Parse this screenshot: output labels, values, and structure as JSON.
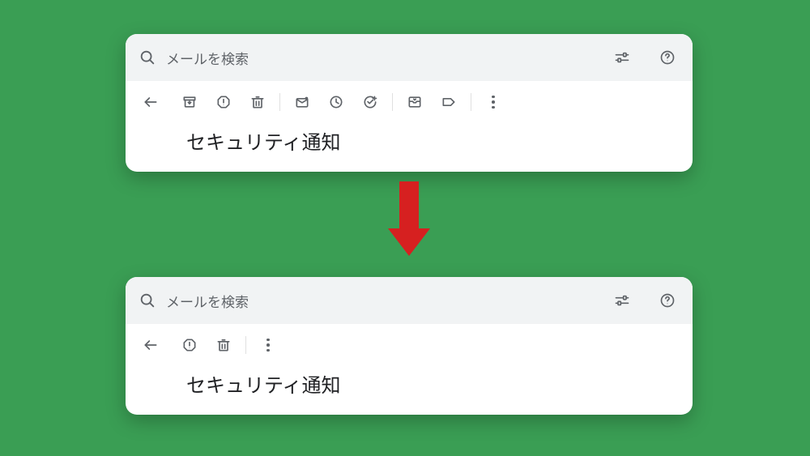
{
  "search": {
    "placeholder": "メールを検索"
  },
  "email": {
    "subject": "セキュリティ通知"
  },
  "icons": {
    "search": "search-icon",
    "filter": "filter-icon",
    "help": "help-icon",
    "back": "back-icon",
    "archive": "archive-icon",
    "report_spam": "report-spam-icon",
    "delete": "delete-icon",
    "mark_unread": "mark-unread-icon",
    "snooze": "snooze-icon",
    "add_task": "add-task-icon",
    "move_to": "move-to-icon",
    "labels": "labels-icon",
    "more": "more-icon"
  },
  "toolbar_top": {
    "groups": [
      [
        "back"
      ],
      [
        "archive",
        "report_spam",
        "delete"
      ],
      [
        "mark_unread",
        "snooze",
        "add_task"
      ],
      [
        "move_to",
        "labels"
      ],
      [
        "more"
      ]
    ]
  },
  "toolbar_bottom": {
    "groups": [
      [
        "back"
      ],
      [
        "report_spam",
        "delete"
      ],
      [
        "more"
      ]
    ]
  }
}
